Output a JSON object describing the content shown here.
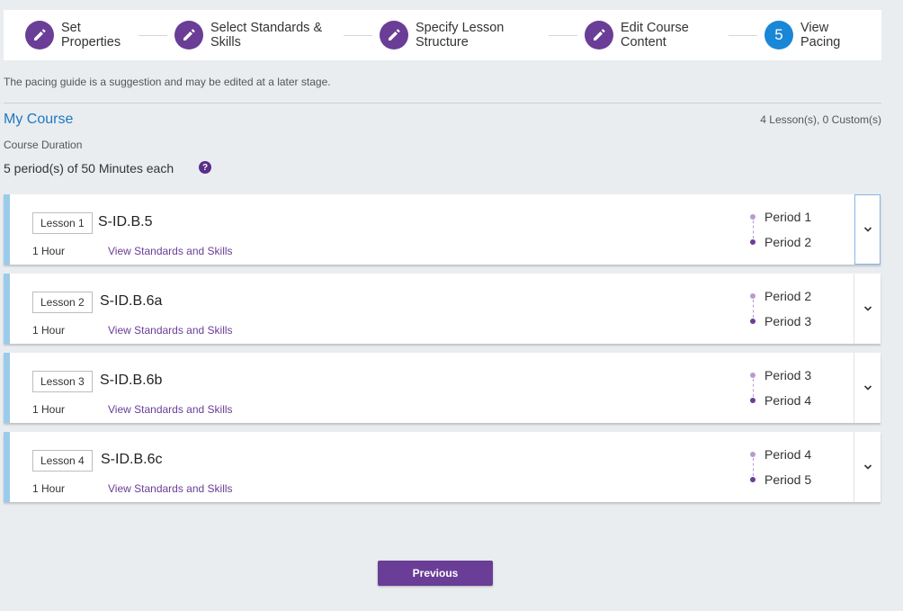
{
  "stepper": {
    "steps": [
      {
        "label_line1": "Set",
        "label_line2": "Properties",
        "icon": "pencil-icon"
      },
      {
        "label_line1": "Select Standards &",
        "label_line2": "Skills",
        "icon": "pencil-icon"
      },
      {
        "label_line1": "Specify Lesson",
        "label_line2": "Structure",
        "icon": "pencil-icon"
      },
      {
        "label_line1": "Edit Course",
        "label_line2": "Content",
        "icon": "pencil-icon"
      },
      {
        "label_line1": "View",
        "label_line2": "Pacing",
        "number": "5"
      }
    ]
  },
  "note": "The pacing guide is a suggestion and may be edited at a later stage.",
  "course": {
    "title": "My Course",
    "count": "4 Lesson(s), 0 Custom(s)",
    "duration_label": "Course Duration",
    "duration_value": "5 period(s) of 50 Minutes each",
    "help_glyph": "?"
  },
  "lessons": [
    {
      "tag": "Lesson 1",
      "name": "S-ID.B.5",
      "hours": "1 Hour",
      "link": "View Standards and Skills",
      "period_a": "Period 1",
      "period_b": "Period 2"
    },
    {
      "tag": "Lesson 2",
      "name": "S-ID.B.6a",
      "hours": "1 Hour",
      "link": "View Standards and Skills",
      "period_a": "Period 2",
      "period_b": "Period 3"
    },
    {
      "tag": "Lesson 3",
      "name": "S-ID.B.6b",
      "hours": "1 Hour",
      "link": "View Standards and Skills",
      "period_a": "Period 3",
      "period_b": "Period 4"
    },
    {
      "tag": "Lesson 4",
      "name": "S-ID.B.6c",
      "hours": "1 Hour",
      "link": "View Standards and Skills",
      "period_a": "Period 4",
      "period_b": "Period 5"
    }
  ],
  "buttons": {
    "previous": "Previous"
  },
  "colors": {
    "primary": "#6a3d96",
    "active_step": "#1a86d6",
    "link_blue": "#1f78c1",
    "lesson_bar": "#9ccbea"
  }
}
